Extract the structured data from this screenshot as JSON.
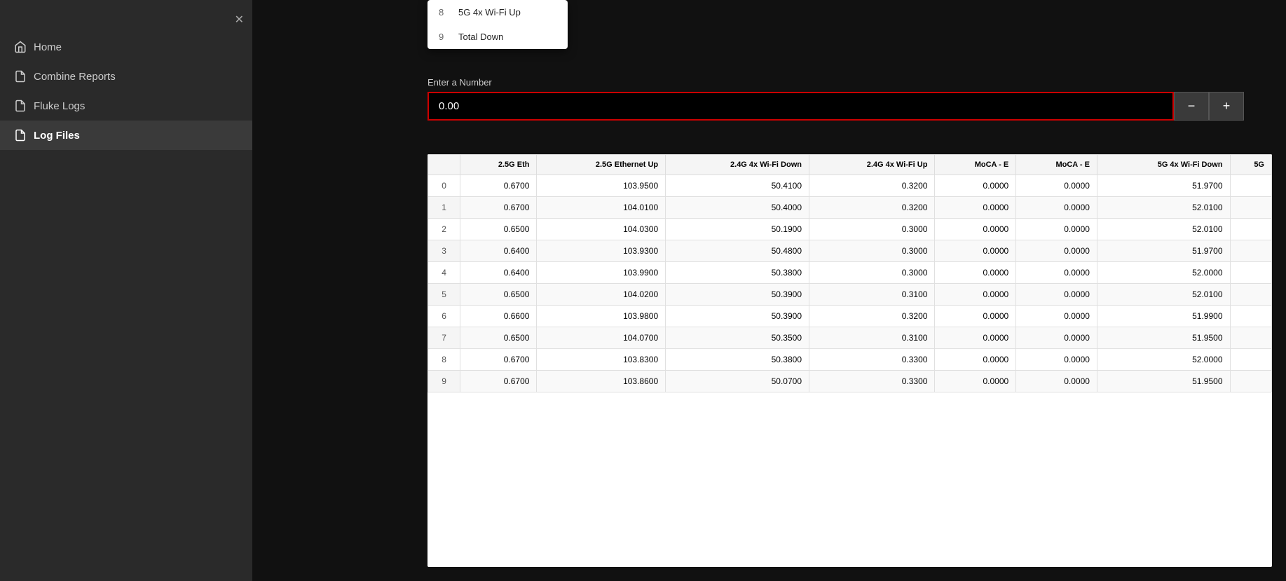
{
  "sidebar": {
    "close_label": "✕",
    "items": [
      {
        "id": "home",
        "label": "Home",
        "active": false
      },
      {
        "id": "combine-reports",
        "label": "Combine Reports",
        "active": false
      },
      {
        "id": "fluke-logs",
        "label": "Fluke Logs",
        "active": false
      },
      {
        "id": "log-files",
        "label": "Log Files",
        "active": true
      }
    ]
  },
  "dropdown": {
    "items": [
      {
        "num": "8",
        "label": "5G 4x Wi-Fi Up"
      },
      {
        "num": "9",
        "label": "Total Down"
      }
    ]
  },
  "number_input": {
    "label": "Enter a Number",
    "value": "0.00",
    "placeholder": "0.00",
    "minus_label": "−",
    "plus_label": "+"
  },
  "table": {
    "headers": [
      "",
      "2.5G Eth",
      "2.5G Ethernet Up",
      "2.4G 4x Wi-Fi Down",
      "2.4G 4x Wi-Fi Up",
      "MoCA - E",
      "MoCA - E",
      "5G 4x Wi-Fi Down",
      "5G"
    ],
    "rows": [
      {
        "idx": 0,
        "c1": "0.6700",
        "c2": "103.9500",
        "c3": "50.4100",
        "c4": "0.3200",
        "c5": "0.0000",
        "c6": "0.0000",
        "c7": "51.9700",
        "c8": ""
      },
      {
        "idx": 1,
        "c1": "0.6700",
        "c2": "104.0100",
        "c3": "50.4000",
        "c4": "0.3200",
        "c5": "0.0000",
        "c6": "0.0000",
        "c7": "52.0100",
        "c8": ""
      },
      {
        "idx": 2,
        "c1": "0.6500",
        "c2": "104.0300",
        "c3": "50.1900",
        "c4": "0.3000",
        "c5": "0.0000",
        "c6": "0.0000",
        "c7": "52.0100",
        "c8": ""
      },
      {
        "idx": 3,
        "c1": "0.6400",
        "c2": "103.9300",
        "c3": "50.4800",
        "c4": "0.3000",
        "c5": "0.0000",
        "c6": "0.0000",
        "c7": "51.9700",
        "c8": ""
      },
      {
        "idx": 4,
        "c1": "0.6400",
        "c2": "103.9900",
        "c3": "50.3800",
        "c4": "0.3000",
        "c5": "0.0000",
        "c6": "0.0000",
        "c7": "52.0000",
        "c8": ""
      },
      {
        "idx": 5,
        "c1": "0.6500",
        "c2": "104.0200",
        "c3": "50.3900",
        "c4": "0.3100",
        "c5": "0.0000",
        "c6": "0.0000",
        "c7": "52.0100",
        "c8": ""
      },
      {
        "idx": 6,
        "c1": "0.6600",
        "c2": "103.9800",
        "c3": "50.3900",
        "c4": "0.3200",
        "c5": "0.0000",
        "c6": "0.0000",
        "c7": "51.9900",
        "c8": ""
      },
      {
        "idx": 7,
        "c1": "0.6500",
        "c2": "104.0700",
        "c3": "50.3500",
        "c4": "0.3100",
        "c5": "0.0000",
        "c6": "0.0000",
        "c7": "51.9500",
        "c8": ""
      },
      {
        "idx": 8,
        "c1": "0.6700",
        "c2": "103.8300",
        "c3": "50.3800",
        "c4": "0.3300",
        "c5": "0.0000",
        "c6": "0.0000",
        "c7": "52.0000",
        "c8": ""
      },
      {
        "idx": 9,
        "c1": "0.6700",
        "c2": "103.8600",
        "c3": "50.0700",
        "c4": "0.3300",
        "c5": "0.0000",
        "c6": "0.0000",
        "c7": "51.9500",
        "c8": ""
      }
    ]
  }
}
